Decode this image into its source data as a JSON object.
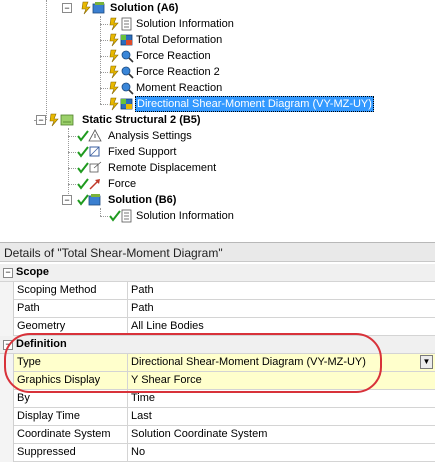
{
  "tree": {
    "solution_a6": "Solution (A6)",
    "a6_children": [
      "Solution Information",
      "Total Deformation",
      "Force Reaction",
      "Force Reaction 2",
      "Moment Reaction",
      "Directional Shear-Moment Diagram (VY-MZ-UY)"
    ],
    "static_structural_2": "Static Structural 2 (B5)",
    "b5_children": [
      "Analysis Settings",
      "Fixed Support",
      "Remote Displacement",
      "Force"
    ],
    "solution_b6": "Solution (B6)",
    "b6_children": [
      "Solution Information"
    ]
  },
  "details": {
    "title": "Details of \"Total Shear-Moment Diagram\"",
    "scope_section": "Scope",
    "scope_rows": [
      {
        "name": "Scoping Method",
        "value": "Path"
      },
      {
        "name": "Path",
        "value": "Path"
      },
      {
        "name": "Geometry",
        "value": "All Line Bodies"
      }
    ],
    "definition_section": "Definition",
    "definition_rows": [
      {
        "name": "Type",
        "value": "Directional Shear-Moment Diagram (VY-MZ-UY)"
      },
      {
        "name": "Graphics Display",
        "value": "Y Shear Force"
      },
      {
        "name": "By",
        "value": "Time"
      },
      {
        "name": "Display Time",
        "value": "Last"
      },
      {
        "name": "Coordinate System",
        "value": "Solution Coordinate System"
      },
      {
        "name": "Suppressed",
        "value": "No"
      }
    ]
  },
  "colors": {
    "selection": "#3399ff",
    "field_yellow": "#ffffcc",
    "highlight_red": "#d8323a",
    "check_green": "#1f9a1f",
    "lightning_yellow": "#e8b800"
  }
}
